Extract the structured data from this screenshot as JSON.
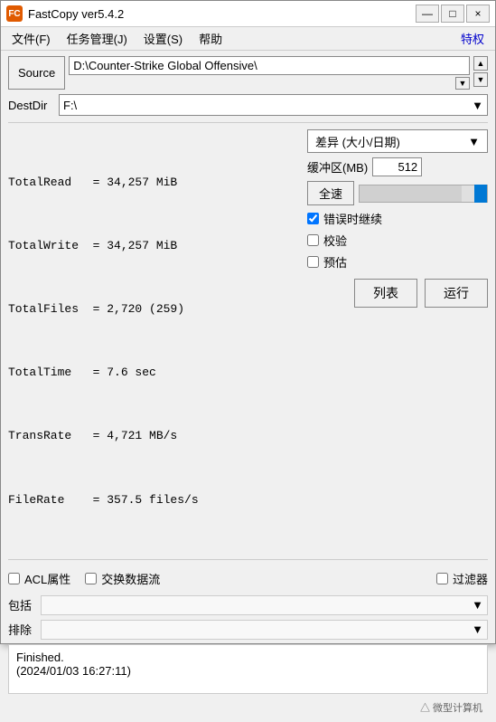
{
  "window": {
    "title": "FastCopy ver5.4.2",
    "app_icon": "FC",
    "minimize_label": "—",
    "maximize_label": "□",
    "close_label": "×"
  },
  "menu": {
    "items": [
      {
        "label": "文件(F)"
      },
      {
        "label": "任务管理(J)"
      },
      {
        "label": "设置(S)"
      },
      {
        "label": "帮助"
      }
    ],
    "special": "特权"
  },
  "source": {
    "button_label": "Source",
    "path": "D:\\Counter-Strike Global Offensive\\",
    "scroll_up": "▲",
    "scroll_down": "▼",
    "dropdown": "▼"
  },
  "destdir": {
    "label": "DestDir",
    "path": "F:\\",
    "dropdown": "▼"
  },
  "stats": {
    "lines": [
      "TotalRead   = 34,257 MiB",
      "TotalWrite  = 34,257 MiB",
      "TotalFiles  = 2,720 (259)",
      "TotalTime   = 7.6 sec",
      "TransRate   = 4,721 MB/s",
      "FileRate    = 357.5 files/s"
    ]
  },
  "options": {
    "diff_select": {
      "label": "差异 (大小/日期)",
      "dropdown": "▼"
    },
    "buffer": {
      "label": "缓冲区(MB)",
      "value": "512"
    },
    "speed": {
      "label": "全速"
    },
    "checkboxes": {
      "error_continue": {
        "label": "错误时继续",
        "checked": true
      },
      "verify": {
        "label": "校验",
        "checked": false
      },
      "estimate": {
        "label": "预估",
        "checked": false
      }
    }
  },
  "action_buttons": {
    "list": "列表",
    "run": "运行"
  },
  "bottom_options": {
    "acl": {
      "label": "ACL属性",
      "checked": false
    },
    "stream": {
      "label": "交换数据流",
      "checked": false
    },
    "filter": {
      "label": "过滤器",
      "checked": false
    }
  },
  "filter_rows": {
    "include": {
      "label": "包括",
      "placeholder": "",
      "dropdown": "▼"
    },
    "exclude": {
      "label": "排除",
      "placeholder": "",
      "dropdown": "▼"
    }
  },
  "status": {
    "line1": "Finished.",
    "line2": "(2024/01/03 16:27:11)"
  },
  "watermark": "△ 微型计算机"
}
